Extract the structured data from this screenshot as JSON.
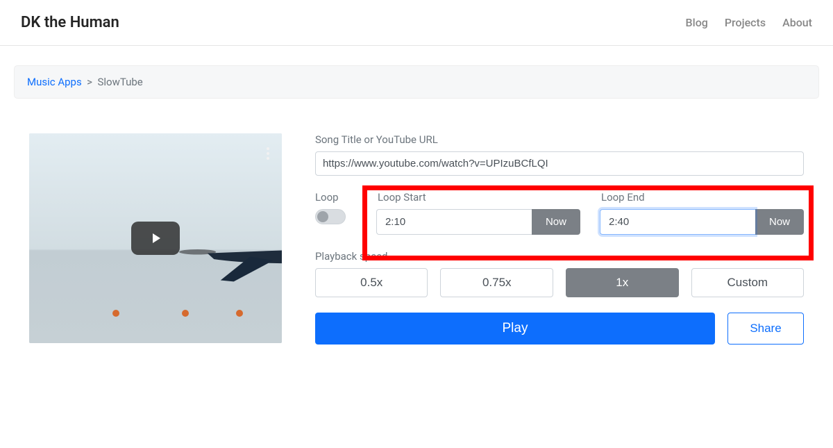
{
  "header": {
    "site_title": "DK the Human",
    "nav": {
      "blog": "Blog",
      "projects": "Projects",
      "about": "About"
    }
  },
  "breadcrumb": {
    "parent": "Music Apps",
    "separator": ">",
    "current": "SlowTube"
  },
  "form": {
    "url_label": "Song Title or YouTube URL",
    "url_value": "https://www.youtube.com/watch?v=UPIzuBCfLQI",
    "loop": {
      "toggle_label": "Loop",
      "start_label": "Loop Start",
      "start_value": "2:10",
      "start_now": "Now",
      "end_label": "Loop End",
      "end_value": "2:40",
      "end_now": "Now"
    },
    "speed": {
      "label": "Playback speed",
      "opt_05": "0.5x",
      "opt_075": "0.75x",
      "opt_1": "1x",
      "opt_custom": "Custom"
    },
    "play": "Play",
    "share": "Share"
  }
}
